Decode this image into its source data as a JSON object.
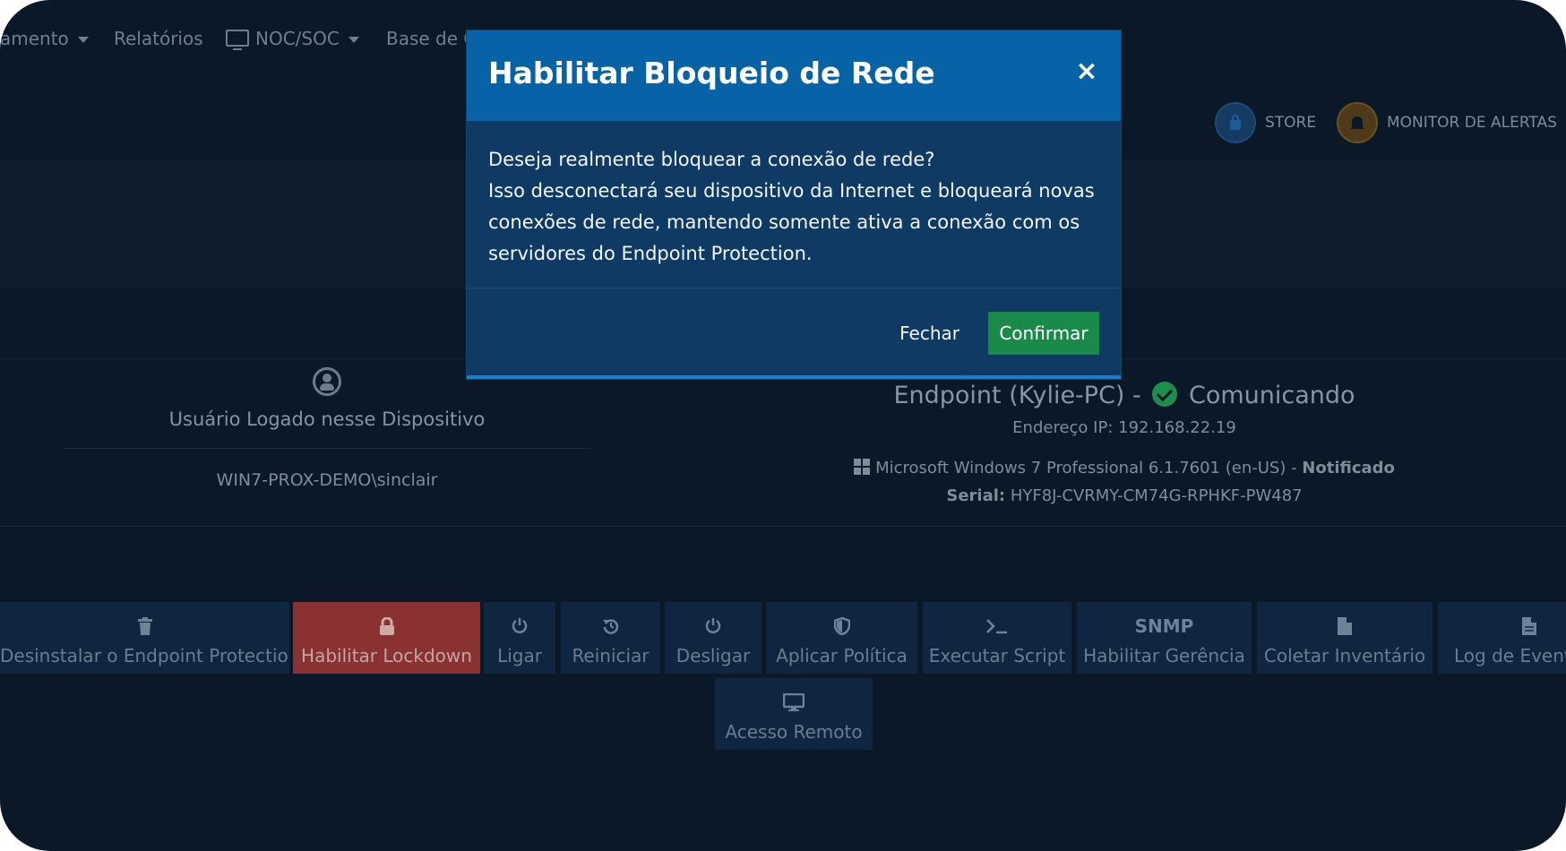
{
  "nav": {
    "items": [
      {
        "label": "amento",
        "has_caret": true
      },
      {
        "label": "Relatórios",
        "has_caret": false
      },
      {
        "label": "NOC/SOC",
        "has_caret": true,
        "icon": "monitor-icon"
      },
      {
        "label": "Base de C",
        "has_caret": false
      }
    ]
  },
  "topright": {
    "store_label": "STORE",
    "alerts_label": "MONITOR DE ALERTAS"
  },
  "user_panel": {
    "title": "Usuário Logado nesse Dispositivo",
    "username": "WIN7-PROX-DEMO\\sinclair"
  },
  "endpoint": {
    "name": "Endpoint (Kylie-PC) -",
    "status": "Comunicando",
    "status_color": "#1f8e4c",
    "ip_label": "Endereço IP:",
    "ip_value": "192.168.22.19",
    "os_text": "Microsoft Windows 7 Professional 6.1.7601 (en-US) -",
    "os_status": "Notificado",
    "serial_label": "Serial:",
    "serial_value": "HYF8J-CVRMY-CM74G-RPHKF-PW487"
  },
  "actions": [
    {
      "label": "Desinstalar o Endpoint Protection",
      "icon": "trash-icon"
    },
    {
      "label": "Habilitar Lockdown",
      "icon": "lock-icon",
      "danger": true
    },
    {
      "label": "Ligar",
      "icon": "power-icon"
    },
    {
      "label": "Reiniciar",
      "icon": "restart-icon"
    },
    {
      "label": "Desligar",
      "icon": "power-icon"
    },
    {
      "label": "Aplicar Política",
      "icon": "shield-icon"
    },
    {
      "label": "Executar Script",
      "icon": "terminal-icon"
    },
    {
      "label": "Habilitar Gerência",
      "icon_text": "SNMP"
    },
    {
      "label": "Coletar Inventário",
      "icon": "file-icon"
    },
    {
      "label": "Log de Evento",
      "icon": "file-icon"
    },
    {
      "label": "Acesso Remoto",
      "icon": "monitor-icon"
    }
  ],
  "modal": {
    "title": "Habilitar Bloqueio de Rede",
    "close_glyph": "×",
    "body_line1": "Deseja realmente bloquear a conexão de rede?",
    "body_line2": "Isso desconectará seu dispositivo da Internet e bloqueará novas conexões de rede, mantendo somente ativa a conexão com os servidores do Endpoint Protection.",
    "cancel_label": "Fechar",
    "confirm_label": "Confirmar",
    "header_color": "#0763a6",
    "confirm_color": "#1a8a4a"
  }
}
